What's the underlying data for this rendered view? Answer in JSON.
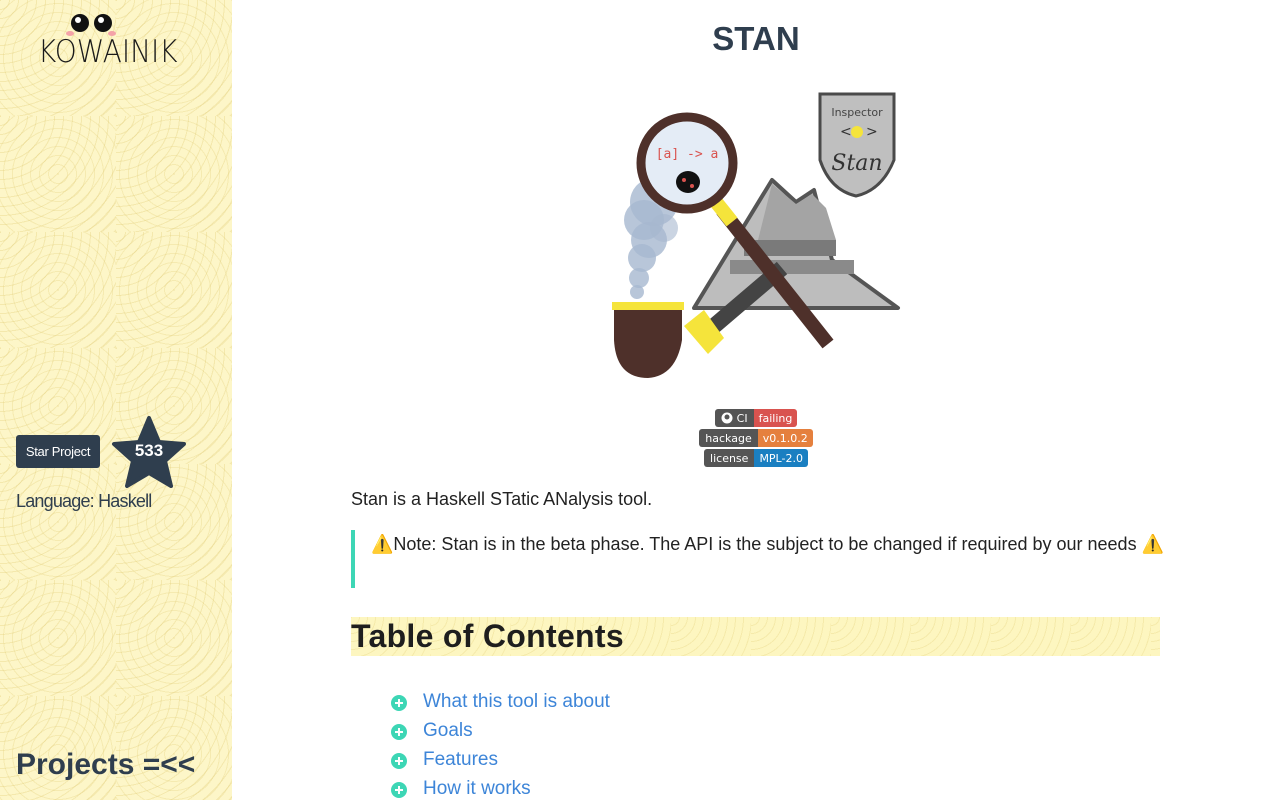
{
  "sidebar": {
    "logo_text": "KOWAINIK",
    "star_button_label": "Star Project",
    "star_count": "533",
    "language": "Language: Haskell",
    "projects_link": "Projects =<<"
  },
  "main": {
    "title": "STAN",
    "hero_image": {
      "badge_text": "Inspector",
      "badge_name": "Stan",
      "lens_text": "[a] -> a"
    },
    "badges": [
      {
        "label": "CI",
        "value": "failing",
        "color": "#d9534f"
      },
      {
        "label": "hackage",
        "value": "v0.1.0.2",
        "color": "#e5803e"
      },
      {
        "label": "license",
        "value": "MPL-2.0",
        "color": "#1a7fc1"
      }
    ],
    "intro": "Stan is a Haskell STatic ANalysis tool.",
    "note": "⚠️Note: Stan is in the beta phase. The API is the subject to be changed if required by our needs ⚠️",
    "toc_heading": "Table of Contents",
    "toc_items": [
      "What this tool is about",
      "Goals",
      "Features",
      "How it works"
    ]
  },
  "colors": {
    "accent": "#3dd6b5",
    "link": "#3d85d8",
    "dark": "#2f3e4e",
    "sidebar_bg": "#fdf6c8"
  }
}
